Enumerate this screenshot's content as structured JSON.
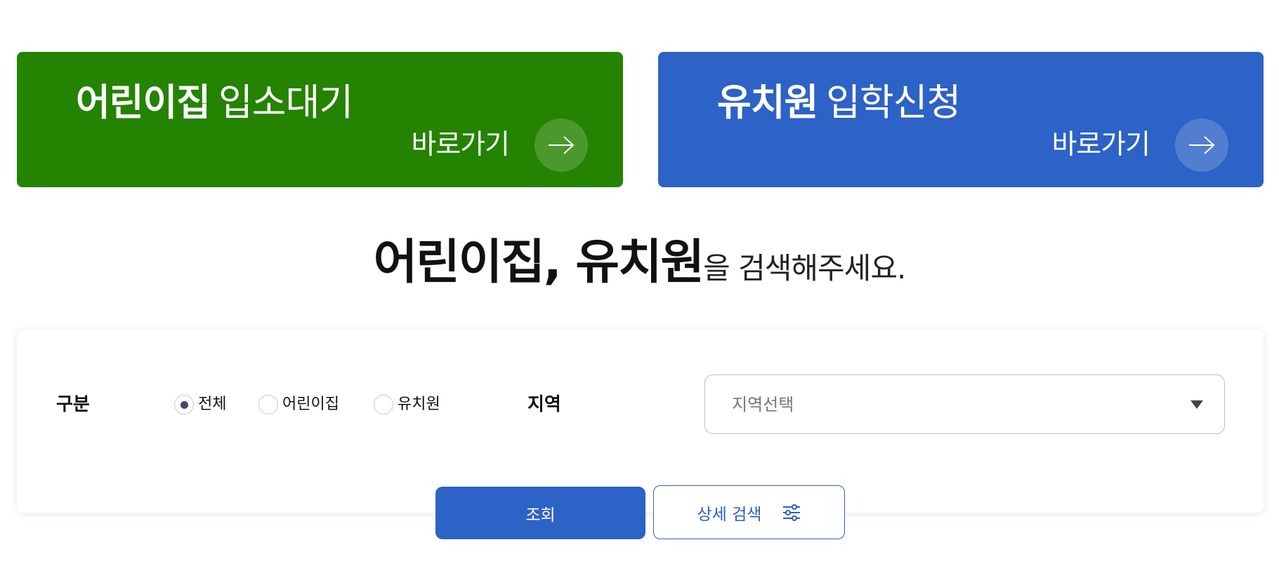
{
  "colors": {
    "green": "#248300",
    "blue": "#2d62c6"
  },
  "banners": [
    {
      "strong": "어린이집",
      "light": "입소대기",
      "goto": "바로가기",
      "icon": "arrow-right-icon"
    },
    {
      "strong": "유치원",
      "light": "입학신청",
      "goto": "바로가기",
      "icon": "arrow-right-icon"
    }
  ],
  "heading": {
    "strong": "어린이집, 유치원",
    "rest": "을 검색해주세요."
  },
  "search": {
    "category_label": "구분",
    "options": [
      "전체",
      "어린이집",
      "유치원"
    ],
    "selected": "전체",
    "region_label": "지역",
    "region_placeholder": "지역선택",
    "search_button": "조회",
    "detail_button": "상세 검색",
    "detail_icon": "filter-sliders-icon"
  }
}
